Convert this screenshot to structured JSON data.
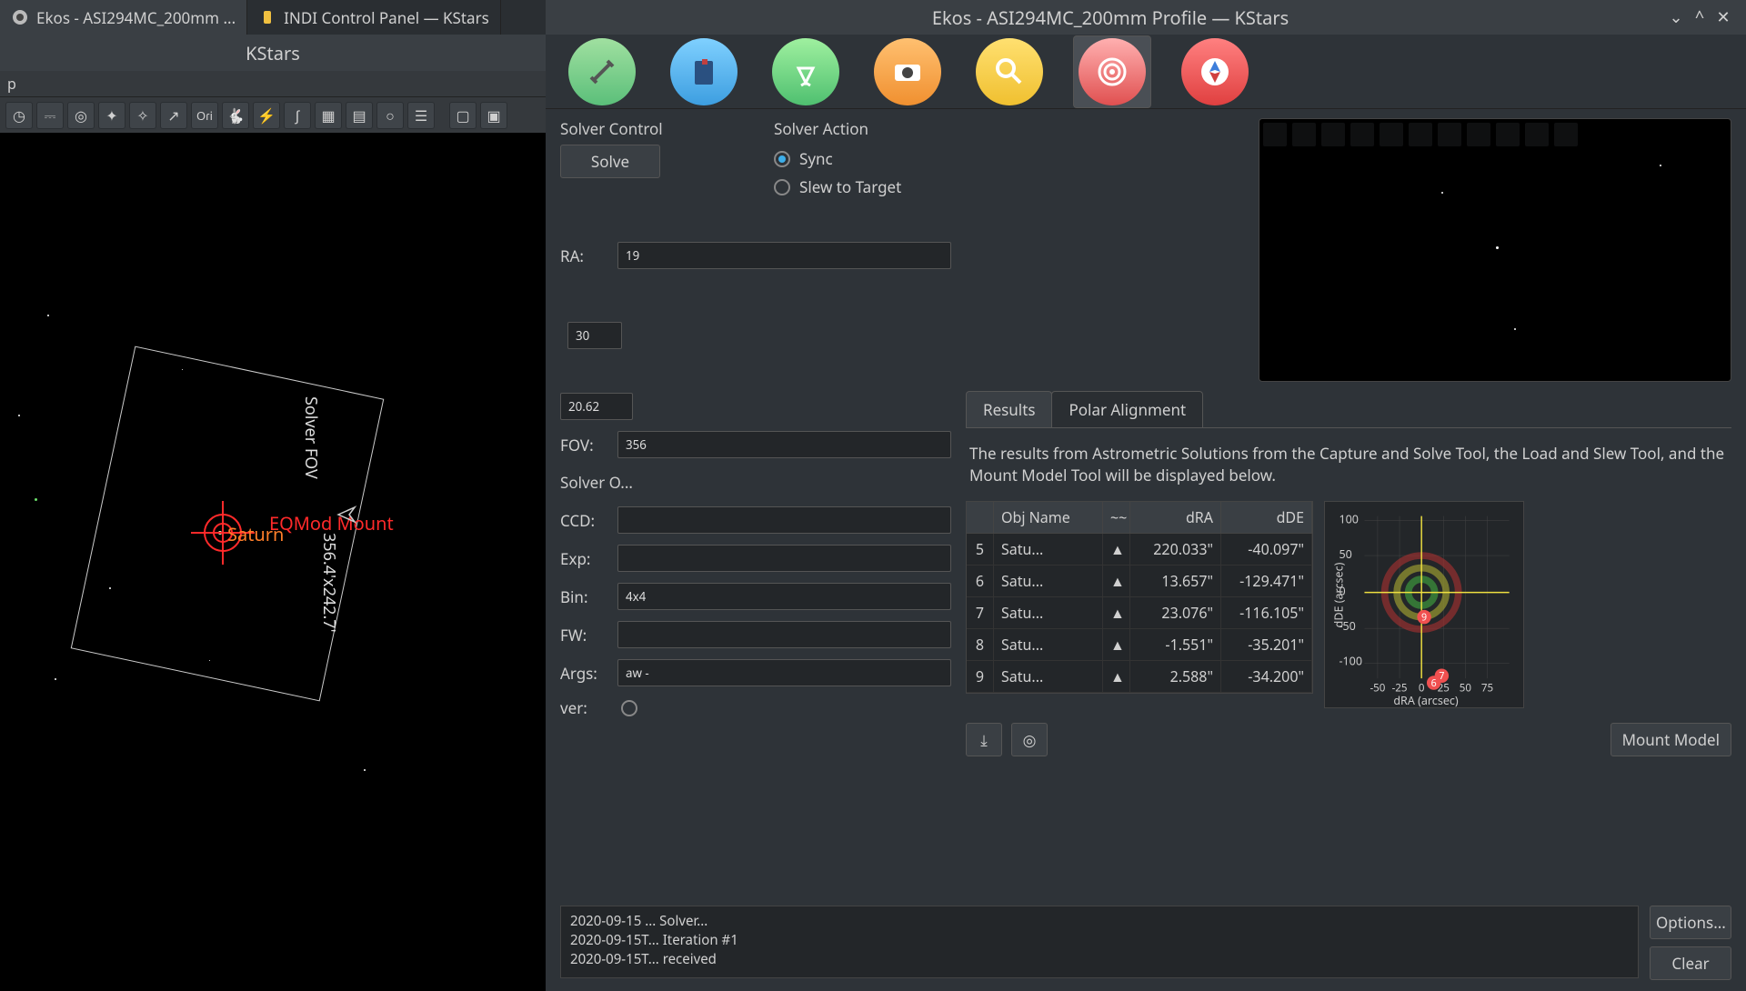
{
  "taskbar": {
    "items": [
      {
        "label": "Ekos - ASI294MC_200mm ...",
        "icon": "kstars-icon"
      },
      {
        "label": "INDI Control Panel — KStars",
        "icon": "indi-icon"
      }
    ]
  },
  "kstars": {
    "title": "KStars",
    "menu_help": "p",
    "sky": {
      "saturn_label": "Saturn",
      "mount_label": "EQMod Mount",
      "fov_title": "Solver FOV",
      "fov_dims": "356.4'x242.7'"
    },
    "toolbar_icons": [
      "clock",
      "link",
      "target",
      "star",
      "wand",
      "arrow",
      "ori",
      "rabbit",
      "bolt",
      "curve",
      "grid",
      "grid2",
      "circle",
      "list",
      "|",
      "box",
      "box2"
    ]
  },
  "ekos": {
    "title": "Ekos - ASI294MC_200mm Profile — KStars",
    "tabs": [
      "setup",
      "logs",
      "mount",
      "camera",
      "focus",
      "align",
      "guide"
    ],
    "active_tab": 5,
    "solver_control": {
      "title": "Solver Control",
      "solve_button": "Solve"
    },
    "solver_action": {
      "title": "Solver Action",
      "sync": "Sync",
      "slew": "Slew to Target"
    },
    "telescope": {
      "ra_label": "RA:",
      "ra_value": "19",
      "fov_label": "FOV:",
      "fov_value": "356",
      "value_20": "20.62"
    },
    "solver_options": {
      "title": "Solver O...",
      "ccd_label": "CCD:",
      "exp_label": "Exp:",
      "bin_label": "Bin:",
      "bin_value": "4x4",
      "fw_label": "FW:",
      "args_label": "Args:",
      "args_value": "aw -",
      "solver_label": "ver:"
    },
    "accuracy": {
      "value": "30"
    },
    "results": {
      "subtabs": {
        "results": "Results",
        "polar": "Polar Alignment"
      },
      "description": "The results from Astrometric Solutions from the Capture and Solve Tool, the Load and Slew Tool, and the Mount Model Tool will be displayed below.",
      "headers": {
        "obj": "Obj Name",
        "sort": "~~",
        "dra": "dRA",
        "dde": "dDE"
      },
      "rows": [
        {
          "i": "5",
          "name": "Satu...",
          "dra": "220.033\"",
          "dde": "-40.097\""
        },
        {
          "i": "6",
          "name": "Satu...",
          "dra": "13.657\"",
          "dde": "-129.471\""
        },
        {
          "i": "7",
          "name": "Satu...",
          "dra": "23.076\"",
          "dde": "-116.105\""
        },
        {
          "i": "8",
          "name": "Satu...",
          "dra": "-1.551\"",
          "dde": "-35.201\""
        },
        {
          "i": "9",
          "name": "Satu...",
          "dra": "2.588\"",
          "dde": "-34.200\""
        }
      ],
      "mount_model_btn": "Mount Model"
    },
    "chart_data": {
      "type": "scatter",
      "title": "",
      "xlabel": "dRA (arcsec)",
      "ylabel": "dDE (arcsec)",
      "xlim": [
        -75,
        75
      ],
      "ylim": [
        -100,
        100
      ],
      "xticks": [
        -50,
        -25,
        0,
        25,
        50,
        75
      ],
      "yticks": [
        -100,
        -50,
        0,
        50,
        100
      ],
      "points": [
        {
          "label": "9",
          "x": 3,
          "y": -34
        },
        {
          "label": "7",
          "x": 23,
          "y": -116
        },
        {
          "label": "6",
          "x": 14,
          "y": -129
        }
      ],
      "rings": [
        25,
        50,
        75,
        100
      ],
      "crosshair": {
        "x": 0,
        "y": 0
      }
    },
    "log": {
      "lines": [
        "2020-09-15 ... Solver...",
        "2020-09-15T...  Iteration #1",
        "2020-09-15T...  received"
      ]
    },
    "buttons": {
      "options": "Options...",
      "clear": "Clear"
    }
  }
}
